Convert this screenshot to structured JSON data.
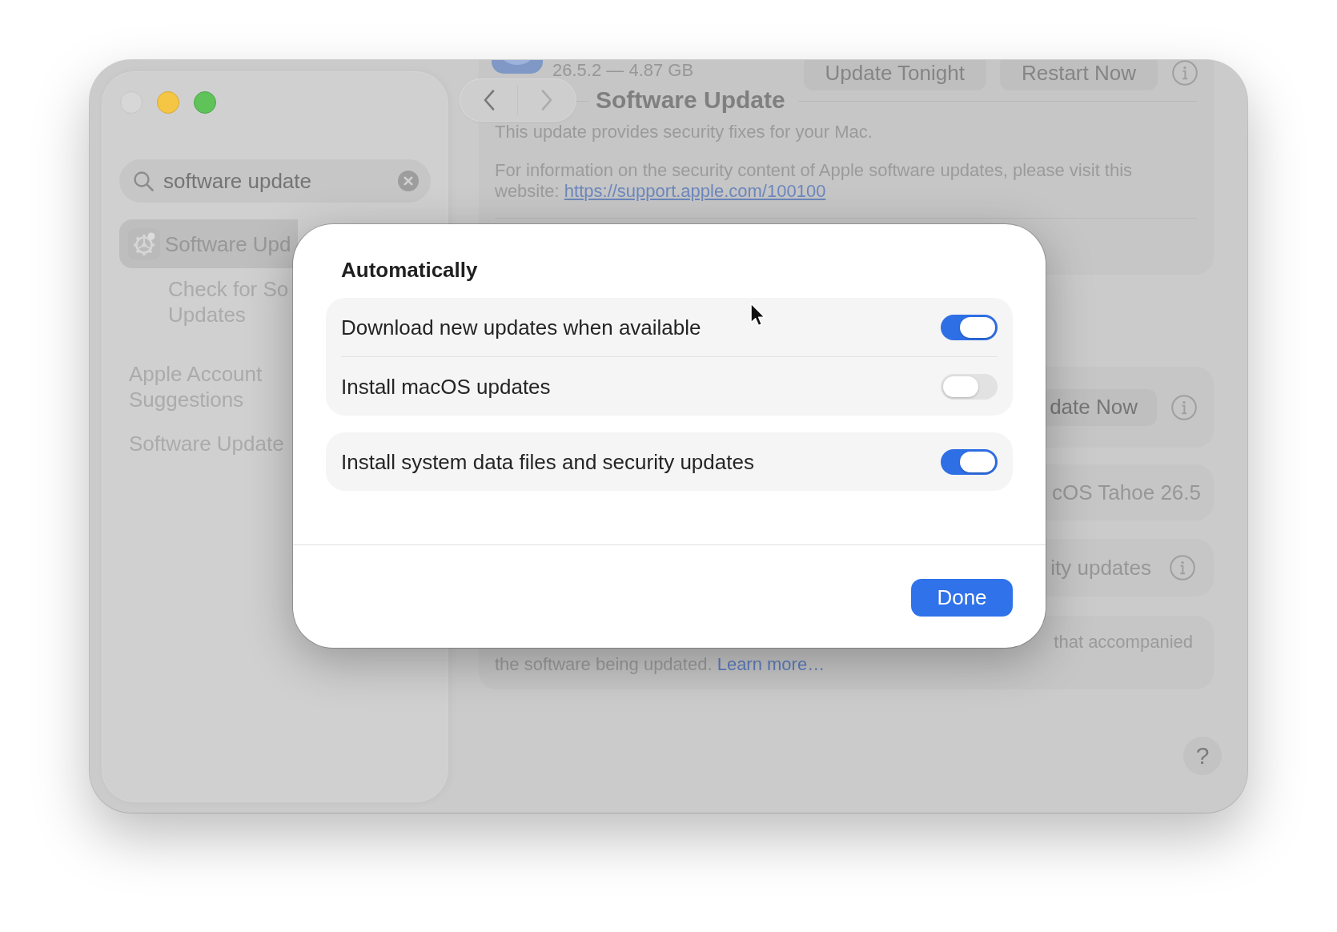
{
  "window": {
    "controls": [
      {
        "kind": "close",
        "disabled": true
      },
      {
        "kind": "minimize",
        "disabled": false
      },
      {
        "kind": "zoom",
        "disabled": false
      }
    ]
  },
  "sidebar": {
    "search": {
      "value": "software update"
    },
    "items": [
      {
        "kind": "pane",
        "lines": [
          "Software Upd"
        ],
        "selected": true
      },
      {
        "kind": "subitem",
        "lines": [
          "Check for So",
          "Updates"
        ],
        "selected": false
      },
      {
        "kind": "result",
        "lines": [
          "Apple Account",
          "Suggestions"
        ],
        "selected": false
      },
      {
        "kind": "result",
        "lines": [
          "Software Update"
        ],
        "selected": false
      }
    ]
  },
  "toolbar": {
    "navigation": [
      {
        "kind": "back",
        "disabled": false
      },
      {
        "kind": "forward",
        "disabled": true
      }
    ],
    "title": "Software Update"
  },
  "update": {
    "detail": "26.5.2 — 4.87 GB",
    "buttons": [
      "Update Tonight",
      "Restart Now"
    ],
    "description": "This update provides security fixes for your Mac.",
    "note": "For information on the security content of Apple software updates, please visit this website:",
    "link": "https://support.apple.com/100100"
  },
  "settings": [
    {
      "kind": "button",
      "label": "date Now",
      "info": true
    },
    {
      "kind": "value",
      "label": "cOS Tahoe 26.5",
      "info": false
    },
    {
      "kind": "text",
      "label": "ity updates",
      "info": true
    },
    {
      "kind": "note",
      "fragment": "that accompanied",
      "text": "the software being updated.",
      "link": "Learn more…"
    }
  ],
  "help": "?",
  "dialog": {
    "heading": "Automatically",
    "groups": [
      {
        "rows": [
          {
            "label": "Download new updates when available",
            "on": true
          },
          {
            "label": "Install macOS updates",
            "on": false
          }
        ]
      },
      {
        "rows": [
          {
            "label": "Install system data files and security updates",
            "on": true
          }
        ]
      }
    ],
    "button": "Done"
  }
}
